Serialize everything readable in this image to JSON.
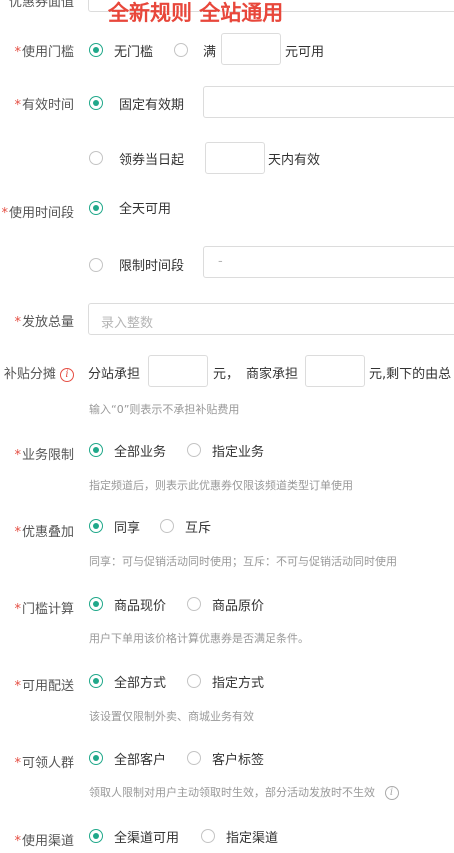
{
  "banner": "全新规则 全站通用",
  "top_label": "优惠券面值",
  "rows": {
    "threshold": {
      "label": "使用门槛",
      "opt1": "无门槛",
      "opt2": "满",
      "suffix": "元可用"
    },
    "valid_time": {
      "label": "有效时间",
      "opt1": "固定有效期",
      "opt2": "领券当日起",
      "suffix": "天内有效"
    },
    "time_period": {
      "label": "使用时间段",
      "opt1": "全天可用",
      "opt2": "限制时间段",
      "range_sep": "-"
    },
    "total": {
      "label": "发放总量",
      "placeholder": "录入整数"
    },
    "subsidy": {
      "label": "补贴分摊",
      "part1": "分站承担",
      "part2": "元，",
      "part3": "商家承担",
      "part4": "元,剩下的由总",
      "hint": "输入“0”则表示不承担补贴费用"
    },
    "business": {
      "label": "业务限制",
      "opt1": "全部业务",
      "opt2": "指定业务",
      "hint": "指定频道后，则表示此优惠券仅限该频道类型订单使用"
    },
    "stacking": {
      "label": "优惠叠加",
      "opt1": "同享",
      "opt2": "互斥",
      "hint": "同享：可与促销活动同时使用；互斥：不可与促销活动同时使用"
    },
    "calc": {
      "label": "门槛计算",
      "opt1": "商品现价",
      "opt2": "商品原价",
      "hint": "用户下单用该价格计算优惠券是否满足条件。"
    },
    "delivery": {
      "label": "可用配送",
      "opt1": "全部方式",
      "opt2": "指定方式",
      "hint": "该设置仅限制外卖、商城业务有效"
    },
    "audience": {
      "label": "可领人群",
      "opt1": "全部客户",
      "opt2": "客户标签",
      "hint": "领取人限制对用户主动领取时生效，部分活动发放时不生效"
    },
    "channel": {
      "label": "使用渠道",
      "opt1": "全渠道可用",
      "opt2": "指定渠道"
    }
  }
}
